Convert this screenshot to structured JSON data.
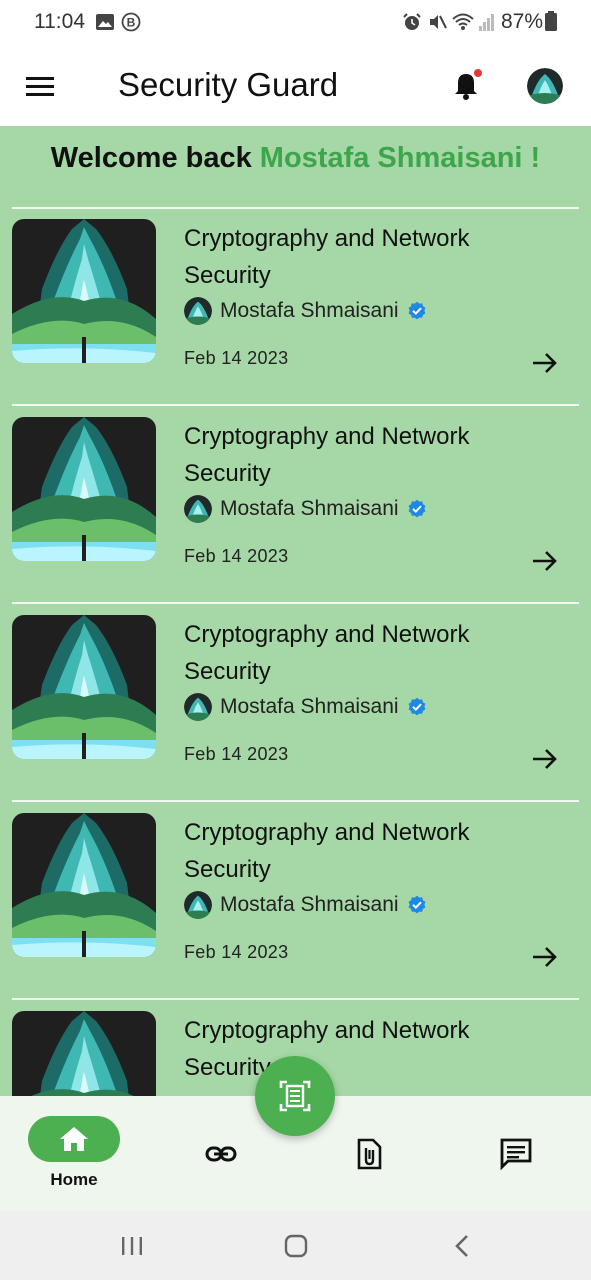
{
  "status_bar": {
    "time": "11:04",
    "battery": "87%"
  },
  "app_bar": {
    "title": "Security Guard",
    "has_notification_dot": true,
    "notification_dot_color": "#e53935"
  },
  "welcome": {
    "prefix": "Welcome back",
    "user_name": "Mostafa Shmaisani !",
    "name_color": "#3ea64a"
  },
  "courses": [
    {
      "title": "Cryptography and Network Security",
      "author": "Mostafa Shmaisani",
      "date": "Feb 14 2023"
    },
    {
      "title": "Cryptography and Network Security",
      "author": "Mostafa Shmaisani",
      "date": "Feb 14 2023"
    },
    {
      "title": "Cryptography and Network Security",
      "author": "Mostafa Shmaisani",
      "date": "Feb 14 2023"
    },
    {
      "title": "Cryptography and Network Security",
      "author": "Mostafa Shmaisani",
      "date": "Feb 14 2023"
    },
    {
      "title": "Cryptography and Network Security",
      "author": "",
      "date": ""
    }
  ],
  "fab": {
    "icon": "document-scanner-icon"
  },
  "bottom_nav": {
    "items": [
      {
        "label": "Home",
        "icon": "home-icon",
        "active": true
      },
      {
        "label": "",
        "icon": "link-icon",
        "active": false
      },
      {
        "label": "",
        "icon": "file-attachment-icon",
        "active": false
      },
      {
        "label": "",
        "icon": "chat-icon",
        "active": false
      }
    ]
  },
  "colors": {
    "primary": "#4caf50",
    "background": "#a6d7a6",
    "verified": "#1e88e5"
  }
}
